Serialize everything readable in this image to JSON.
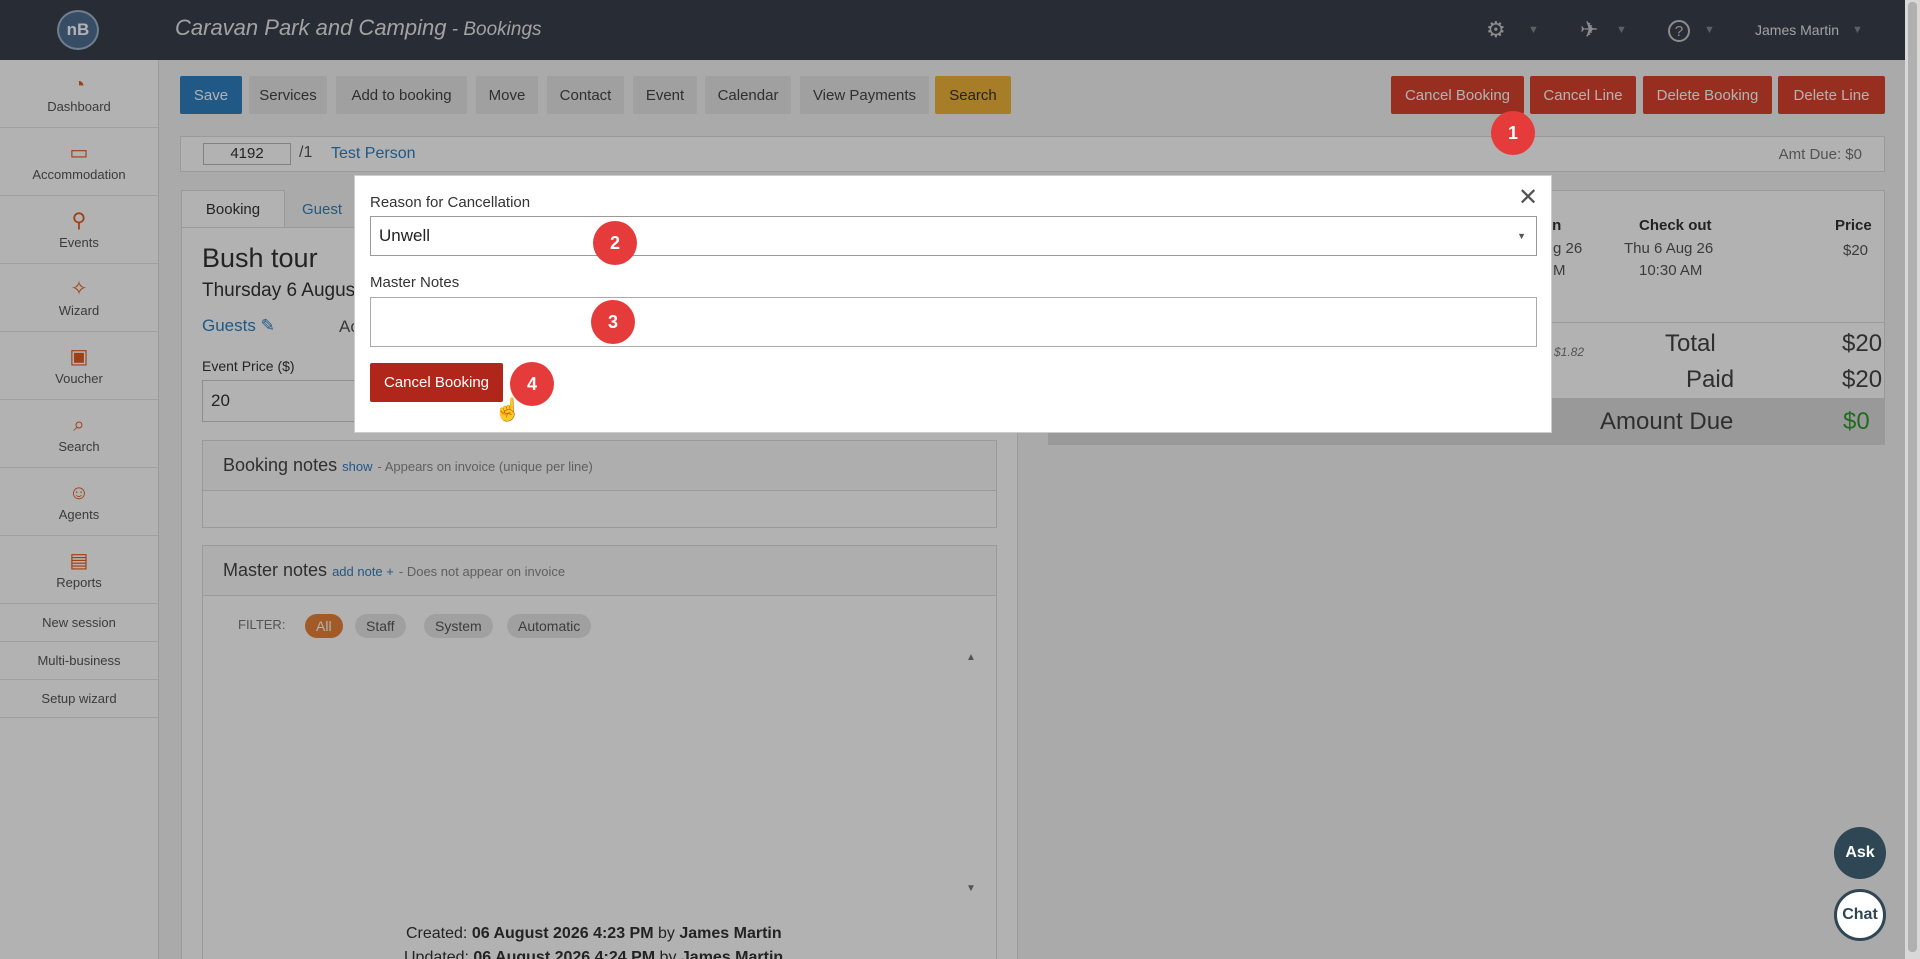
{
  "app": {
    "logo_text": "nB",
    "title": "Caravan Park and Camping",
    "title_suffix": " - Bookings",
    "user": "James Martin"
  },
  "sidebar": {
    "items": [
      {
        "label": "Dashboard",
        "icon": "dashboard-icon"
      },
      {
        "label": "Accommodation",
        "icon": "bed-icon"
      },
      {
        "label": "Events",
        "icon": "events-icon"
      },
      {
        "label": "Wizard",
        "icon": "wand-icon"
      },
      {
        "label": "Voucher",
        "icon": "gift-icon"
      },
      {
        "label": "Search",
        "icon": "search-icon"
      },
      {
        "label": "Agents",
        "icon": "agents-icon"
      },
      {
        "label": "Reports",
        "icon": "report-icon"
      }
    ],
    "links": [
      "New session",
      "Multi-business",
      "Setup wizard"
    ]
  },
  "toolbar": {
    "save": "Save",
    "services": "Services",
    "add_to_booking": "Add to booking",
    "move": "Move",
    "contact": "Contact",
    "event": "Event",
    "calendar": "Calendar",
    "view_payments": "View Payments",
    "search": "Search",
    "cancel_booking": "Cancel Booking",
    "cancel_line": "Cancel Line",
    "delete_booking": "Delete Booking",
    "delete_line": "Delete Line"
  },
  "booking": {
    "id": "4192",
    "suffix": "/1",
    "person": "Test Person",
    "amt_due": "Amt Due: $0",
    "tabs": [
      "Booking",
      "Guest"
    ],
    "title": "Bush tour",
    "date": "Thursday 6 Augus",
    "guests_link": "Guests",
    "ac": "Ac",
    "event_price_label": "Event Price ($)",
    "event_price": "20",
    "booking_notes": {
      "title": "Booking notes",
      "link": "show",
      "hint": "- Appears on invoice (unique per line)"
    },
    "master_notes": {
      "title": "Master notes",
      "link": "add note +",
      "hint": "- Does not appear on invoice"
    },
    "filter": {
      "label": "FILTER:",
      "chips": [
        "All",
        "Staff",
        "System",
        "Automatic"
      ]
    },
    "created_label": "Created:",
    "created_date": "06 August 2026 4:23 PM",
    "by": "by",
    "created_by": "James Martin",
    "updated_label": "Updated:",
    "updated_date": "06 August 2026 4:24 PM",
    "updated_by": "James Martin"
  },
  "right_panel": {
    "checkin_head": "in",
    "checkout_head": "Check out",
    "price_head": "Price",
    "checkin_date": "g 26",
    "checkin_time": "M",
    "checkout_date": "Thu 6 Aug 26",
    "checkout_time": "10:30 AM",
    "price": "$20",
    "gst_note": "l $1.82",
    "total_label": "Total",
    "total": "$20",
    "paid_label": "Paid",
    "paid": "$20",
    "amount_due_label": "Amount Due",
    "amount_due": "$0",
    "amount_due_color": "#2e9a2e"
  },
  "modal": {
    "reason_label": "Reason for Cancellation",
    "reason_value": "Unwell",
    "master_notes_label": "Master Notes",
    "master_notes_value": "",
    "submit": "Cancel Booking",
    "close_icon": "close-icon"
  },
  "badges": [
    "1",
    "2",
    "3",
    "4"
  ],
  "chat": {
    "ask": "Ask",
    "chat": "Chat"
  }
}
